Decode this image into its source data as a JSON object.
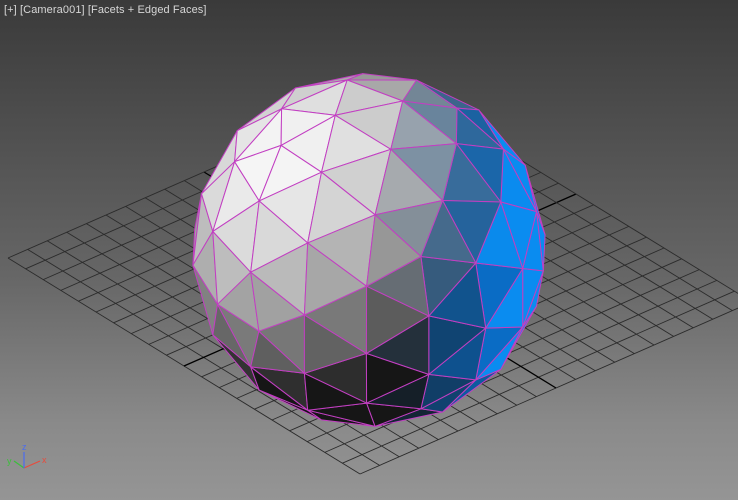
{
  "viewport": {
    "menu_label": "[+]",
    "camera_label": "[Camera001]",
    "shading_label": "[Facets + Edged Faces]"
  },
  "gizmo": {
    "x_label": "x",
    "y_label": "y",
    "z_label": "z",
    "x_color": "#e84b3c",
    "y_color": "#3bbf3b",
    "z_color": "#4a6cf0"
  },
  "colors": {
    "edge": "#c23fc2",
    "grid": "#2b2b2b",
    "grid_center": "#000000",
    "sphere_light": "#eeeeee",
    "sphere_dark": "#1a1a20",
    "sphere_blue": "#1a8fe0"
  }
}
